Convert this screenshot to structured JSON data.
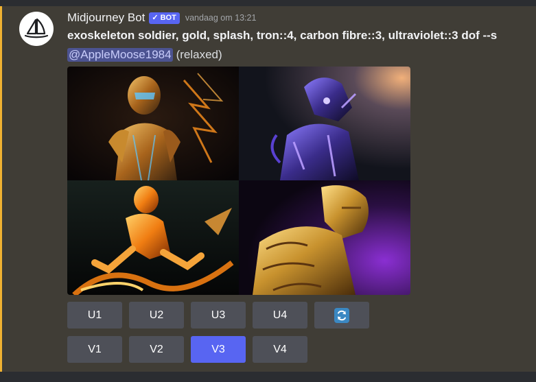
{
  "message": {
    "author": {
      "name": "Midjourney Bot",
      "tag": "BOT",
      "verified_check": "✓",
      "avatar_icon": "sailboat-logo-icon"
    },
    "timestamp": "vandaag om 13:21",
    "prompt": "exoskeleton soldier, gold, splash, tron::4, carbon fibre::3, ultraviolet::3 dof --s",
    "mention": "@AppleMoose1984",
    "mode": "(relaxed)",
    "image_grid": {
      "tiles": [
        {
          "icon": "gold-armored-robot-image"
        },
        {
          "icon": "purple-glowing-armored-figure-image"
        },
        {
          "icon": "golden-splash-fighter-image"
        },
        {
          "icon": "gold-armor-purple-backdrop-image"
        }
      ]
    },
    "upscale_buttons": [
      "U1",
      "U2",
      "U3",
      "U4"
    ],
    "reroll_button": {
      "icon": "refresh-icon"
    },
    "variation_buttons": [
      "V1",
      "V2",
      "V3",
      "V4"
    ],
    "active_variation": "V3"
  },
  "colors": {
    "accent": "#5865f2",
    "mention_bar": "#f0b232",
    "button": "#4e5058",
    "message_bg": "#403d36",
    "refresh": "#3b88c3"
  }
}
